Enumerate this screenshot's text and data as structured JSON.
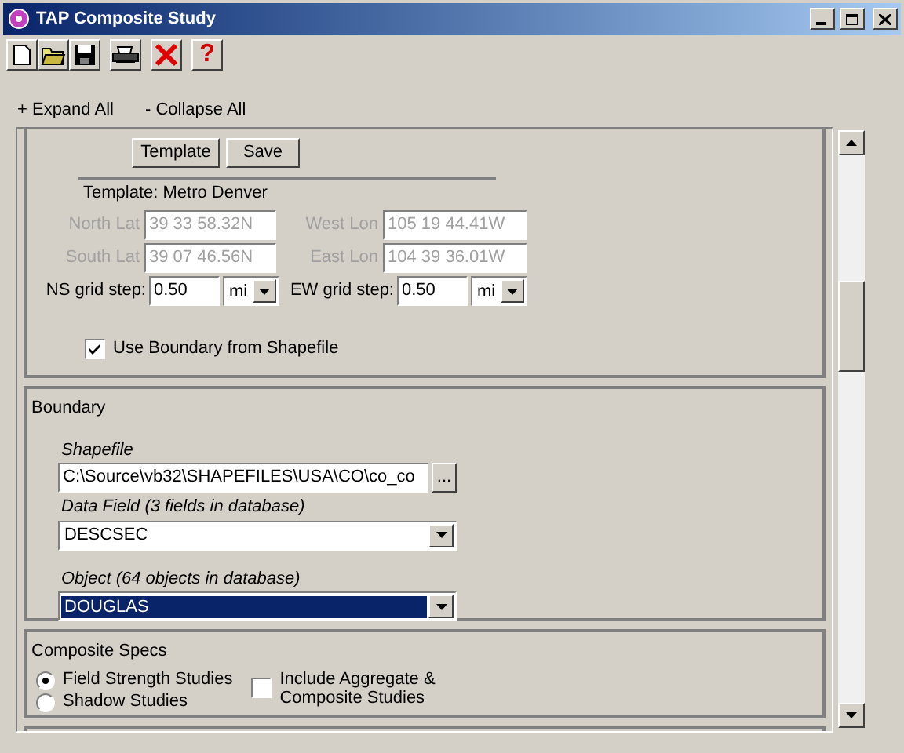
{
  "window": {
    "title": "TAP Composite Study"
  },
  "toolbar": [
    [
      {
        "kind": "new"
      },
      {
        "kind": "open"
      },
      {
        "kind": "save"
      }
    ],
    [
      {
        "kind": "print"
      }
    ],
    [
      {
        "kind": "delete"
      }
    ],
    [
      {
        "kind": "help",
        "glyph": "?"
      }
    ]
  ],
  "links": [
    "+ Expand All",
    "- Collapse All"
  ],
  "location": {
    "buttons": [
      "Template",
      "Save"
    ],
    "template_label": "Template: Metro Denver",
    "coords": [
      {
        "label": "North Lat",
        "value": "39 33 58.32N",
        "disabled": true
      },
      {
        "label": "West Lon",
        "value": "105 19 44.41W",
        "disabled": true
      },
      {
        "label": "South Lat",
        "value": "39 07 46.56N",
        "disabled": true
      },
      {
        "label": "East Lon",
        "value": "104 39 36.01W",
        "disabled": true
      }
    ],
    "grid_steps": [
      {
        "label": "NS grid step:",
        "value": "0.50",
        "unit": "mi"
      },
      {
        "label": "EW grid step:",
        "value": "0.50",
        "unit": "mi"
      }
    ],
    "use_boundary": {
      "label": "Use Boundary from Shapefile",
      "checked": true
    }
  },
  "boundary": {
    "title": "Boundary",
    "shapefile_label": "Shapefile",
    "shapefile": "C:\\Source\\vb32\\SHAPEFILES\\USA\\CO\\co_co",
    "browse": "...",
    "fields": [
      {
        "label": "Data Field (3 fields in database)",
        "value": "DESCSEC",
        "selected": false
      },
      {
        "label": "Object (64 objects in database)",
        "value": "DOUGLAS",
        "selected": true
      }
    ]
  },
  "composite_specs": {
    "title": "Composite Specs",
    "radios": [
      {
        "label": "Field Strength Studies",
        "selected": true
      },
      {
        "label": "Shadow Studies",
        "selected": false
      }
    ],
    "include": {
      "label": "Include Aggregate & Composite Studies",
      "checked": false
    }
  }
}
